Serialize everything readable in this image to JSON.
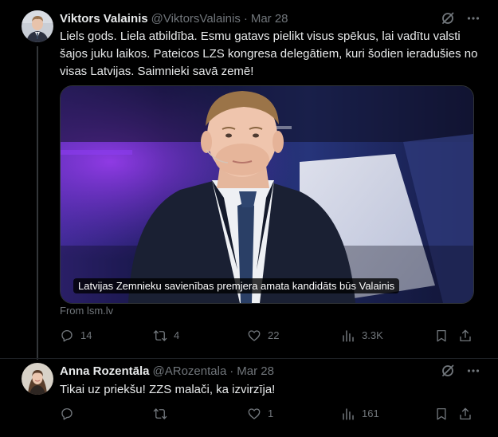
{
  "colors": {
    "background": "#000000",
    "text_primary": "#e7e9ea",
    "text_secondary": "#71767b",
    "divider": "#2f3336"
  },
  "tweets": [
    {
      "author_name": "Viktors Valainis",
      "handle": "@ViktorsValainis",
      "separator": "·",
      "date": "Mar 28",
      "text": "Liels gods. Liela atbildība. Esmu gatavs pielikt visus spēkus, lai vadītu valsti šajos juku laikos. Pateicos LZS kongresa delegātiem, kuri šodien ieradušies no visas Latvijas. Saimnieki savā zemē!",
      "card": {
        "headline": "Latvijas Zemnieku savienības premjera amata kandidāts būs Valainis",
        "source": "From lsm.lv"
      },
      "metrics": {
        "replies": "14",
        "reposts": "4",
        "likes": "22",
        "views": "3.3K"
      }
    },
    {
      "author_name": "Anna Rozentāla",
      "handle": "@ARozentala",
      "separator": "·",
      "date": "Mar 28",
      "text": "Tikai uz priekšu! ZZS malači, ka izvirzīja!",
      "metrics": {
        "replies": "",
        "reposts": "",
        "likes": "1",
        "views": "161"
      }
    }
  ],
  "icons": {
    "grok": "grok-icon",
    "more": "more-icon",
    "reply": "reply-icon",
    "repost": "repost-icon",
    "like": "like-icon",
    "views": "views-icon",
    "bookmark": "bookmark-icon",
    "share": "share-icon"
  }
}
